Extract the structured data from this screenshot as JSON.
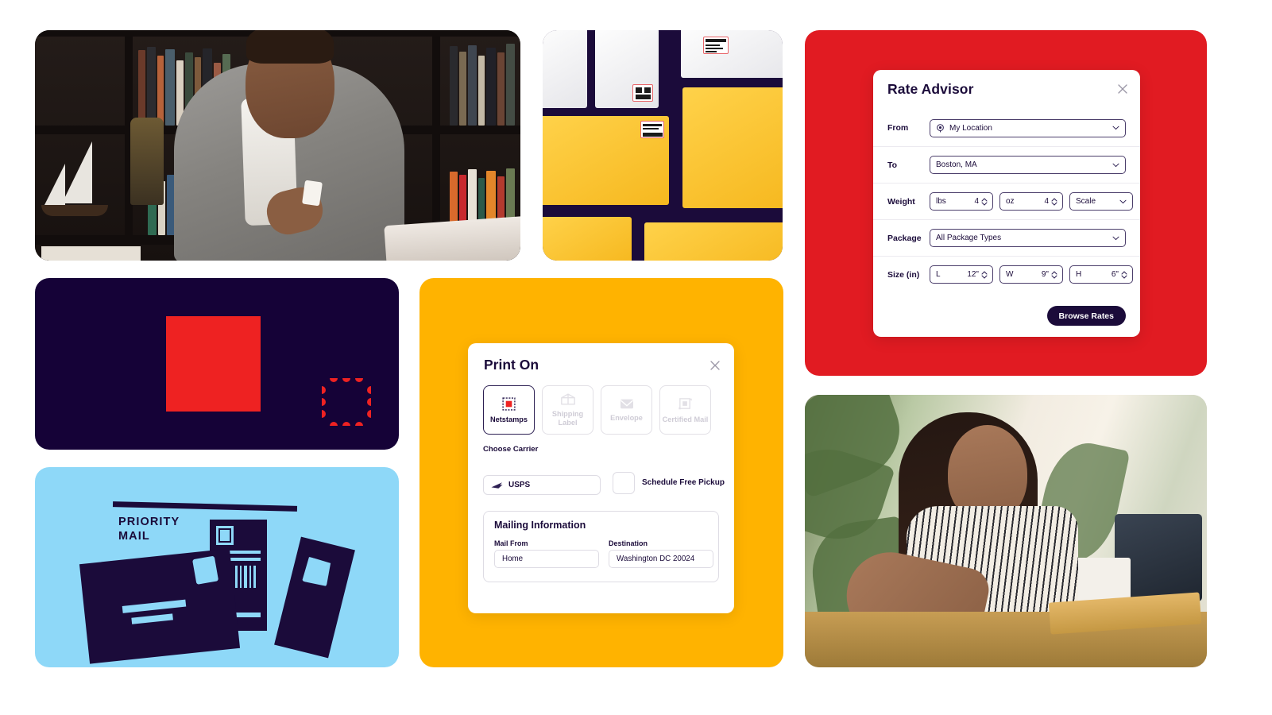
{
  "brand": {
    "navy": "#1b0b3a",
    "red": "#e11b22",
    "yellow": "#ffb300",
    "light_blue": "#8ed8f8",
    "stamp_red": "#ee2222"
  },
  "panels": {
    "photo_man": {
      "alt": "Man in grey blazer holding a postage stamp in front of a bookshelf"
    },
    "photo_envelopes": {
      "alt": "White and yellow padded mailing envelopes with shipping labels on a navy background"
    },
    "photo_woman": {
      "alt": "Woman at a sunlit desk reaching across packing envelopes next to a laptop"
    },
    "logo": {
      "alt": "Stamps.com postage stamp logo mark"
    },
    "priority_mail": {
      "line1": "PRIORITY",
      "line2": "MAIL",
      "alt": "Illustration of Priority Mail envelopes with stamps and a barcode label"
    }
  },
  "rate_advisor": {
    "title": "Rate Advisor",
    "close_label": "Close",
    "rows": [
      {
        "label": "From",
        "value": "My Location",
        "icon": "location-pin-icon",
        "control": "select"
      },
      {
        "label": "To",
        "value": "Boston, MA",
        "control": "select"
      },
      {
        "label": "Weight",
        "control": "weight"
      },
      {
        "label": "Package",
        "value": "All Package Types",
        "control": "select"
      },
      {
        "label": "Size (in)",
        "control": "size"
      }
    ],
    "weight": {
      "lbs": {
        "unit": "lbs",
        "value": "4"
      },
      "oz": {
        "unit": "oz",
        "value": "4"
      },
      "source": "Scale"
    },
    "size": {
      "length": {
        "unit": "L",
        "value": "12\""
      },
      "width": {
        "unit": "W",
        "value": "9\""
      },
      "height": {
        "unit": "H",
        "value": "6\""
      }
    },
    "submit_label": "Browse Rates"
  },
  "print_on": {
    "title": "Print On",
    "close_label": "Close",
    "tiles": [
      {
        "label": "Netstamps",
        "icon": "netstamp-icon",
        "active": true
      },
      {
        "label": "Shipping Label",
        "icon": "shipping-label-icon",
        "active": false
      },
      {
        "label": "Envelope",
        "icon": "envelope-icon",
        "active": false
      },
      {
        "label": "Certified Mail",
        "icon": "certified-mail-icon",
        "active": false
      }
    ],
    "carrier_section_label": "Choose Carrier",
    "carrier": {
      "value": "USPS",
      "icon": "usps-eagle-icon"
    },
    "pickup": {
      "label": "Schedule Free Pickup",
      "checked": false
    },
    "mailing_information": {
      "title": "Mailing Information",
      "mail_from": {
        "label": "Mail From",
        "value": "Home"
      },
      "destination": {
        "label": "Destination",
        "value": "Washington DC 20024"
      }
    }
  }
}
